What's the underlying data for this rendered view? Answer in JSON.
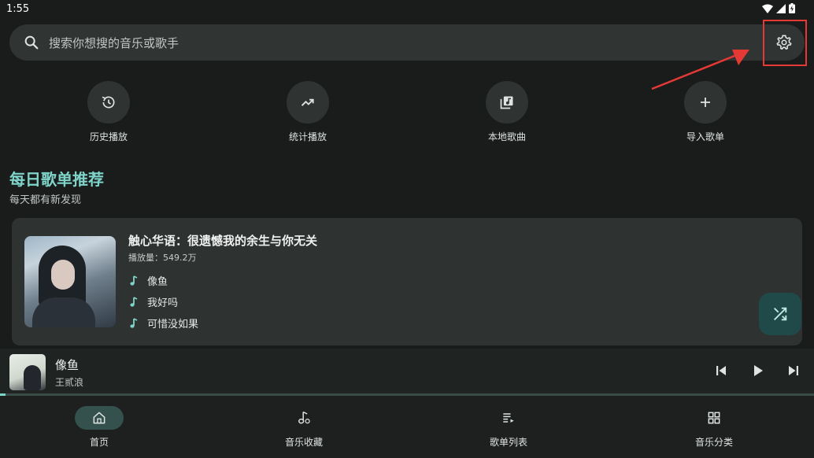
{
  "status_bar": {
    "time": "1:55"
  },
  "search": {
    "placeholder": "搜索你想搜的音乐或歌手"
  },
  "quick_actions": [
    {
      "label": "历史播放",
      "icon": "history-icon"
    },
    {
      "label": "统计播放",
      "icon": "trending-up-icon"
    },
    {
      "label": "本地歌曲",
      "icon": "library-music-icon"
    },
    {
      "label": "导入歌单",
      "icon": "add-icon"
    }
  ],
  "daily": {
    "title": "每日歌单推荐",
    "subtitle": "每天都有新发现",
    "playlist": {
      "title": "触心华语：很遗憾我的余生与你无关",
      "plays": "播放量：549.2万",
      "songs": [
        "像鱼",
        "我好吗",
        "可惜没如果"
      ]
    }
  },
  "now_playing": {
    "title": "像鱼",
    "artist": "王贰浪",
    "progress": 0.007
  },
  "bottom_nav": [
    {
      "label": "首页",
      "icon": "home-icon",
      "active": true
    },
    {
      "label": "音乐收藏",
      "icon": "music-note-icon",
      "active": false
    },
    {
      "label": "歌单列表",
      "icon": "queue-music-icon",
      "active": false
    },
    {
      "label": "音乐分类",
      "icon": "category-icon",
      "active": false
    }
  ],
  "colors": {
    "accent": "#7fd4c9",
    "background": "#191c1b",
    "highlight": "#e53935"
  }
}
